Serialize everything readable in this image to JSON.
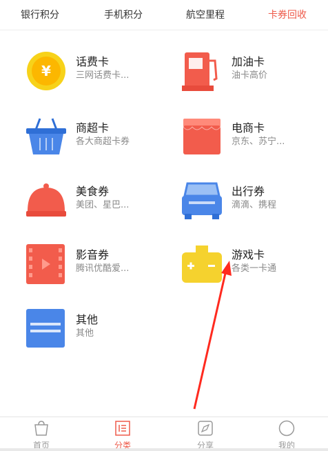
{
  "top_tabs": [
    {
      "label": "银行积分"
    },
    {
      "label": "手机积分"
    },
    {
      "label": "航空里程"
    },
    {
      "label": "卡券回收"
    }
  ],
  "active_tab": "卡券回收",
  "categories": [
    {
      "title": "话费卡",
      "subtitle": "三网话费卡...",
      "icon": "coin-yen-icon"
    },
    {
      "title": "加油卡",
      "subtitle": "油卡高价",
      "icon": "gas-pump-icon"
    },
    {
      "title": "商超卡",
      "subtitle": "各大商超卡券",
      "icon": "shopping-basket-icon"
    },
    {
      "title": "电商卡",
      "subtitle": "京东、苏宁...",
      "icon": "storefront-icon"
    },
    {
      "title": "美食券",
      "subtitle": "美团、星巴...",
      "icon": "food-cloche-icon"
    },
    {
      "title": "出行券",
      "subtitle": "滴滴、携程",
      "icon": "car-icon"
    },
    {
      "title": "影音券",
      "subtitle": "腾讯优酷爱...",
      "icon": "film-play-icon"
    },
    {
      "title": "游戏卡",
      "subtitle": "各类一卡通",
      "icon": "game-controller-icon"
    },
    {
      "title": "其他",
      "subtitle": "其他",
      "icon": "card-lines-icon"
    }
  ],
  "bottom_nav": [
    {
      "label": "首页",
      "icon": "shopping-bag-icon"
    },
    {
      "label": "分类",
      "icon": "category-list-icon"
    },
    {
      "label": "分享",
      "icon": "compass-icon"
    },
    {
      "label": "我的",
      "icon": "profile-circle-icon"
    }
  ],
  "active_nav": "分类",
  "colors": {
    "accent": "#ee5a4a",
    "coin": "#f7d21a",
    "red": "#f25c4c",
    "blue": "#4a86e8",
    "yellow": "#f5d22e"
  }
}
